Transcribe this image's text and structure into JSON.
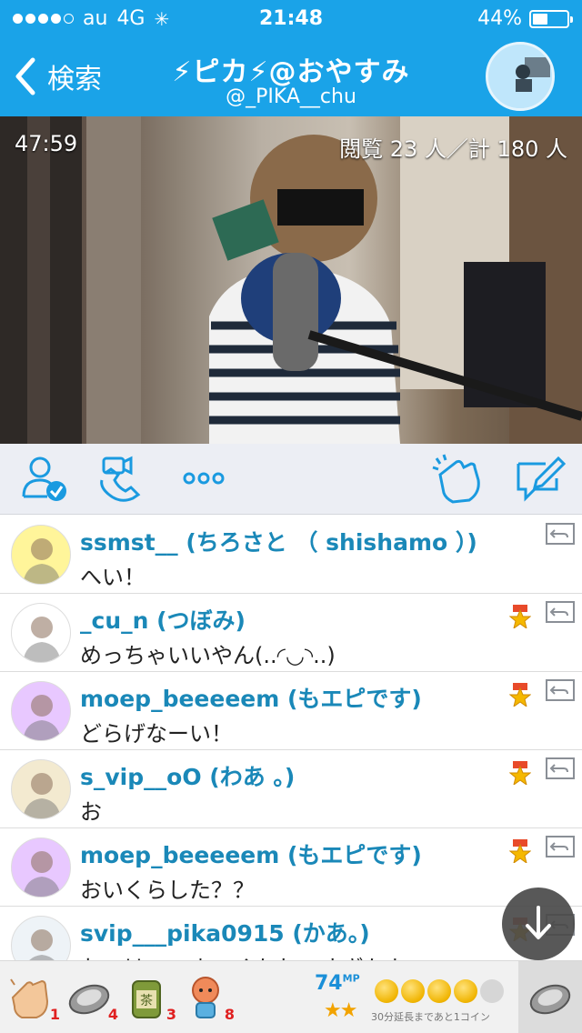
{
  "status_bar": {
    "carrier": "au",
    "network": "4G",
    "time": "21:48",
    "battery": "44%",
    "battery_level": 0.44,
    "signal_bars": 4,
    "signal_total": 5
  },
  "nav": {
    "back_label": "検索",
    "title": "⚡ピカ⚡@おやすみ",
    "subtitle": "@_PIKA__chu"
  },
  "video": {
    "elapsed": "47:59",
    "views": "閲覧 23 人／計 180 人"
  },
  "comments": [
    {
      "name": "ssmst__ (ちろさと （ shishamo ）)",
      "message": "へい！",
      "medal": false,
      "avatar_color": "#fff59a"
    },
    {
      "name": "_cu_n (つぼみ)",
      "message": "めっちゃいいやん(..◜◡◝..)",
      "medal": true,
      "avatar_color": "#ffffff"
    },
    {
      "name": "moep_beeeeem (もエピです)",
      "message": "どらげなーい！",
      "medal": true,
      "avatar_color": "#e8c8ff"
    },
    {
      "name": "s_vip__oO (わあ 。)",
      "message": "お",
      "medal": true,
      "avatar_color": "#f3ead0"
    },
    {
      "name": "moep_beeeeem (もエピです)",
      "message": "おいくらした？？",
      "medal": true,
      "avatar_color": "#e8c8ff"
    },
    {
      "name": "svip___pika0915 (かあ。)",
      "message": "おっはー、まーくかわいすぎかよ…",
      "medal": true,
      "avatar_color": "#eef3f7"
    }
  ],
  "gifts": [
    {
      "icon": "clap-gift-icon",
      "count": "1"
    },
    {
      "icon": "coin-gift-icon",
      "count": "4"
    },
    {
      "icon": "tea-gift-icon",
      "count": "3"
    },
    {
      "icon": "figure-gift-icon",
      "count": "8"
    }
  ],
  "points": {
    "mp_value": "74",
    "mp_unit": "MP",
    "stars": "★★",
    "coins_filled": 4,
    "coins_total": 5,
    "note": "30分延長まであと1コイン"
  },
  "colors": {
    "brand": "#1aa3e8",
    "name_text": "#1a88b8"
  }
}
